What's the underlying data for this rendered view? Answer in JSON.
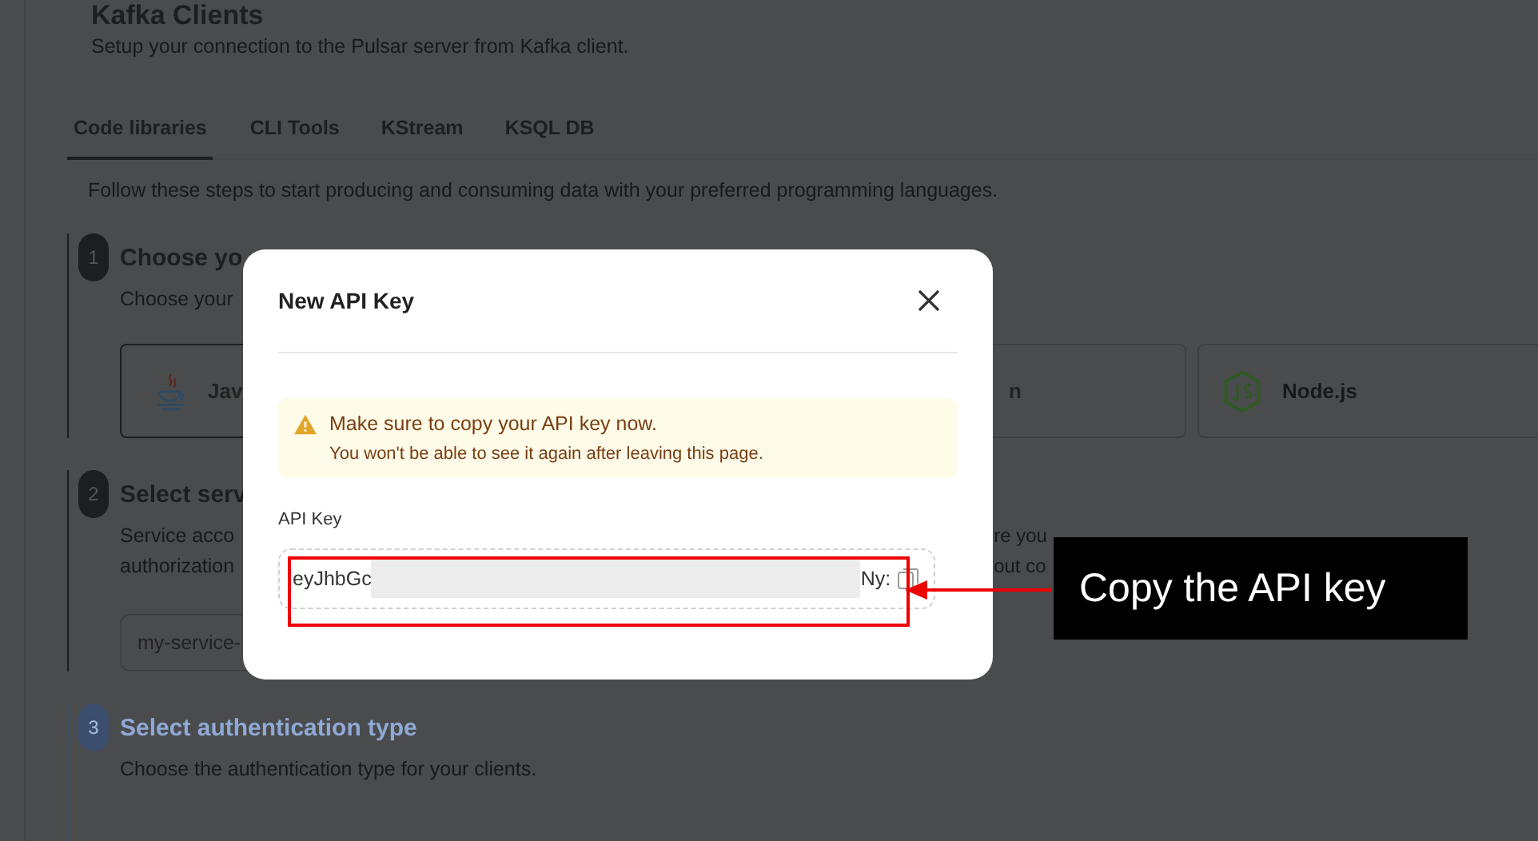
{
  "page": {
    "title": "Kafka Clients",
    "subtitle": "Setup your connection to the Pulsar server from Kafka client.",
    "tabs": [
      {
        "label": "Code libraries",
        "selected": true
      },
      {
        "label": "CLI Tools",
        "selected": false
      },
      {
        "label": "KStream",
        "selected": false
      },
      {
        "label": "KSQL DB",
        "selected": false
      }
    ],
    "intro": "Follow these steps to start producing and consuming data with your preferred programming languages.",
    "steps": [
      {
        "number": "1",
        "title": "Choose yo",
        "description": [
          "Choose your"
        ],
        "active": false,
        "cards": [
          {
            "label": "Jav"
          },
          {
            "label": "n"
          },
          {
            "label": "Node.js"
          }
        ]
      },
      {
        "number": "2",
        "title": "Select serv",
        "description": [
          "Service acco",
          "authorization"
        ],
        "description_right": [
          "re you",
          "out co"
        ],
        "active": false,
        "field_value": "my-service-"
      },
      {
        "number": "3",
        "title": "Select authentication type",
        "description": [
          "Choose the authentication type for your clients."
        ],
        "active": true
      }
    ]
  },
  "modal": {
    "title": "New API Key",
    "alert": {
      "title": "Make sure to copy your API key now.",
      "text": "You won't be able to see it again after leaving this page."
    },
    "field_label": "API Key",
    "key_start": "eyJhbGc",
    "key_end": "Ny:"
  },
  "annotation": {
    "text": "Copy the API key"
  }
}
